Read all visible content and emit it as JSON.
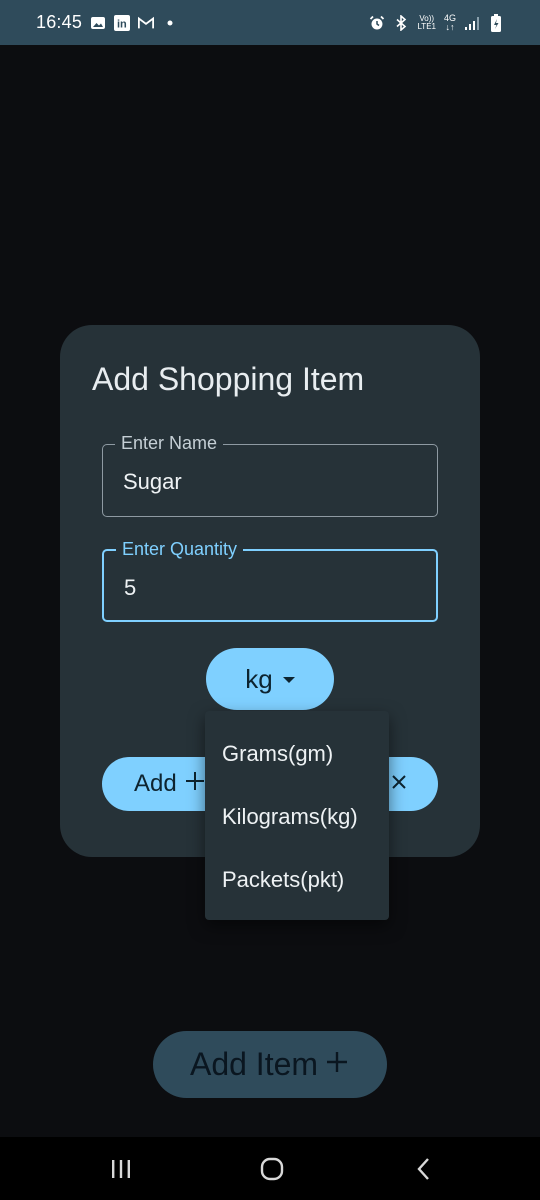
{
  "status_bar": {
    "time": "16:45",
    "left_icons": [
      "gallery-icon",
      "linkedin-icon",
      "gmail-icon",
      "dot-icon"
    ],
    "right_icons": [
      "alarm-icon",
      "bluetooth-icon",
      "volte-icon",
      "network-4g-icon",
      "signal-icon",
      "battery-icon"
    ],
    "volte_top": "Vo))",
    "volte_bottom": "LTE1",
    "network_type": "4G",
    "linkedin_text": "in"
  },
  "dialog": {
    "title": "Add Shopping Item",
    "name_field": {
      "label": "Enter Name",
      "value": "Sugar"
    },
    "quantity_field": {
      "label": "Enter Quantity",
      "value": "5"
    },
    "unit_select": {
      "value": "kg"
    },
    "add_button": {
      "label": "Add",
      "icon": "plus-icon"
    },
    "cancel_button": {
      "label": "",
      "icon": "close-icon"
    }
  },
  "dropdown": {
    "items": [
      "Grams(gm)",
      "Kilograms(kg)",
      "Packets(pkt)"
    ]
  },
  "main": {
    "add_item_button": {
      "label": "Add Item",
      "icon": "plus-icon"
    }
  },
  "nav_bar": {
    "buttons": [
      "recent-apps-icon",
      "home-icon",
      "back-icon"
    ]
  },
  "colors": {
    "accent": "#7fd0ff",
    "dialog_bg": "#263238",
    "status_bar": "#2f4b5b",
    "background": "#0c0d10"
  }
}
